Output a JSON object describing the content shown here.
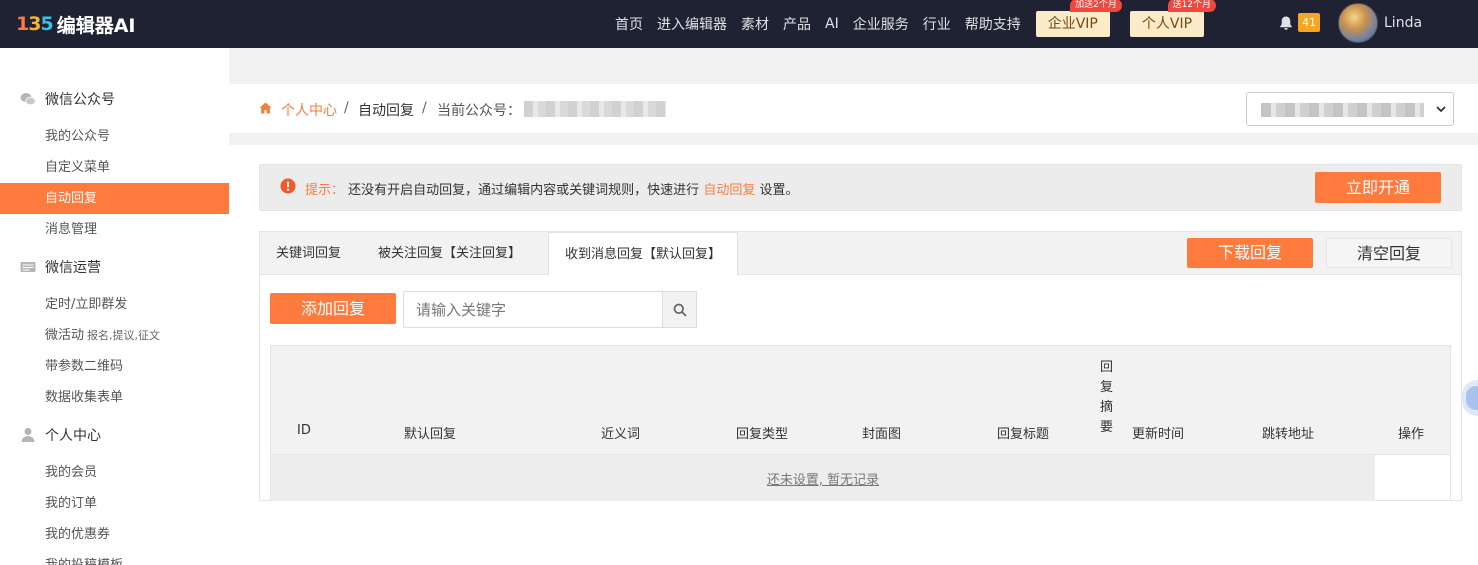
{
  "topbar": {
    "logo_mark": [
      "1",
      "3",
      "5"
    ],
    "logo_text": "编辑器AI",
    "nav": [
      "首页",
      "进入编辑器",
      "素材",
      "产品",
      "AI",
      "企业服务",
      "行业",
      "帮助支持"
    ],
    "vip_enterprise": {
      "label": "企业VIP",
      "tag": "加送2个月"
    },
    "vip_personal": {
      "label": "个人VIP",
      "tag": "送12个月"
    },
    "notification_count": "41",
    "username": "Linda",
    "accent": "#ff7a3d",
    "bg": "#1f2232"
  },
  "sidebar": {
    "sections": [
      {
        "label": "微信公众号",
        "icon": "wechat-icon"
      },
      {
        "label": "微信运营",
        "icon": "card-icon"
      },
      {
        "label": "个人中心",
        "icon": "user-icon"
      }
    ],
    "items": [
      {
        "label": "我的公众号"
      },
      {
        "label": "自定义菜单"
      },
      {
        "label": "自动回复",
        "active": true
      },
      {
        "label": "消息管理"
      },
      {
        "label": "定时/立即群发"
      },
      {
        "label": "微活动",
        "sub": "报名,提议,征文"
      },
      {
        "label": "带参数二维码"
      },
      {
        "label": "数据收集表单"
      },
      {
        "label": "我的会员"
      },
      {
        "label": "我的订单"
      },
      {
        "label": "我的优惠券"
      },
      {
        "label": "我的投稿模板"
      }
    ]
  },
  "breadcrumb": {
    "home": "个人中心",
    "sep": "/",
    "current": "自动回复",
    "account_label": "当前公众号："
  },
  "notice": {
    "prefix": "提示：",
    "text_before": "还没有开启自动回复，通过编辑内容或关键词规则，快速进行",
    "link": "自动回复",
    "text_after": "设置。",
    "button": "立即开通"
  },
  "tabs": [
    {
      "label": "关键词回复"
    },
    {
      "label": "被关注回复【关注回复】"
    },
    {
      "label": "收到消息回复【默认回复】",
      "active": true
    }
  ],
  "actions": {
    "download": "下载回复",
    "clear": "清空回复",
    "add": "添加回复"
  },
  "search": {
    "placeholder": "请输入关键字",
    "value": ""
  },
  "table": {
    "columns": [
      "ID",
      "默认回复",
      "近义词",
      "回复类型",
      "封面图",
      "回复标题",
      "回复摘要",
      "更新时间",
      "跳转地址",
      "操作"
    ],
    "empty": "还未设置, 暂无记录"
  }
}
